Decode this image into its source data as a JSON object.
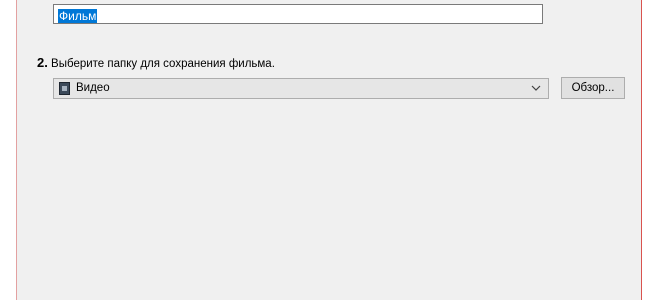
{
  "movie_name": {
    "value": "Фильм"
  },
  "step2": {
    "number": "2.",
    "label": "Выберите папку для сохранения фильма."
  },
  "folder_select": {
    "selected": "Видео",
    "icon": "video-folder-icon"
  },
  "browse_button": {
    "label": "Обзор..."
  }
}
